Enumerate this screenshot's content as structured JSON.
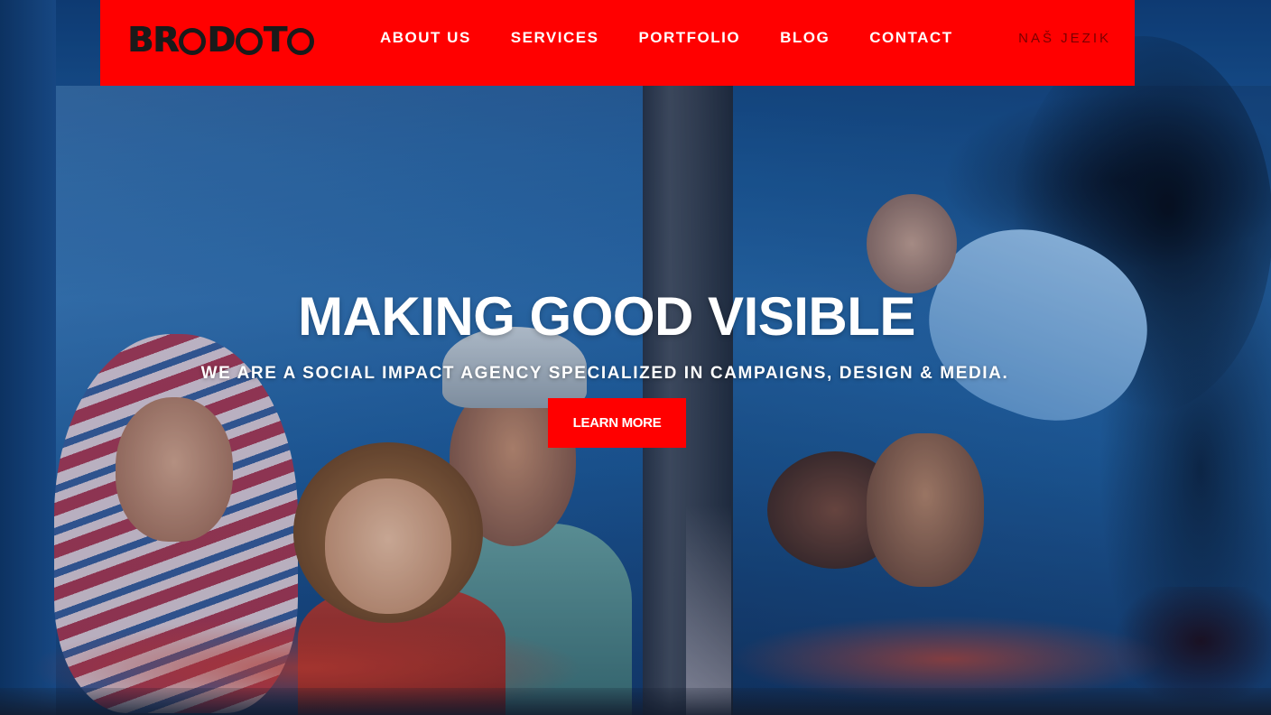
{
  "brand": {
    "logo_text": "BRODOTO",
    "accent_color": "#ff0000"
  },
  "nav": {
    "items": [
      {
        "label": "ABOUT US"
      },
      {
        "label": "SERVICES"
      },
      {
        "label": "PORTFOLIO"
      },
      {
        "label": "BLOG"
      },
      {
        "label": "CONTACT"
      }
    ],
    "language_label": "NAŠ JEZIK"
  },
  "hero": {
    "headline": "MAKING GOOD VISIBLE",
    "subheadline": "WE ARE A SOCIAL IMPACT AGENCY SPECIALIZED IN CAMPAIGNS, DESIGN & MEDIA.",
    "cta_label": "LEARN MORE"
  }
}
